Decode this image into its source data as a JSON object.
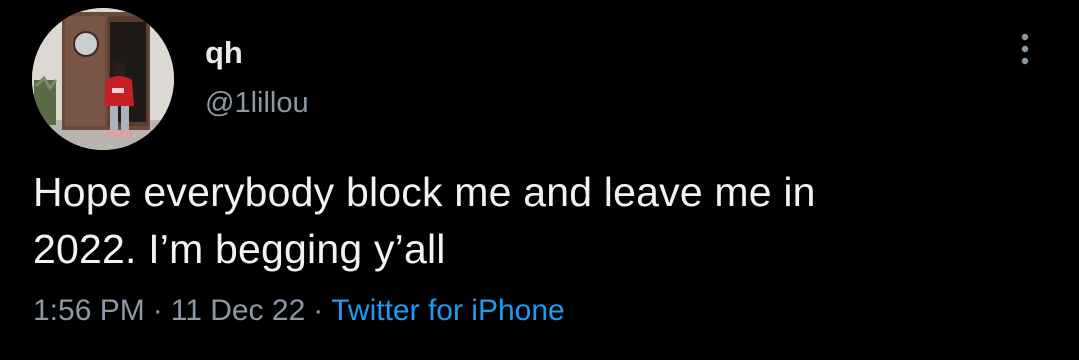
{
  "tweet": {
    "author": {
      "display_name": "qh",
      "handle": "@1lillou",
      "avatar_icon": "avatar-photo"
    },
    "text_lines": [
      "Hope everybody block me and leave me in",
      "2022. I’m begging y’all"
    ],
    "meta": {
      "time": "1:56 PM",
      "date": "11 Dec 22",
      "separator": "·",
      "source": "Twitter for iPhone"
    },
    "more_icon": "more-vertical-icon"
  },
  "colors": {
    "background": "#000000",
    "text": "#e7e9ea",
    "secondary": "#8b98a5",
    "link": "#1d9bf0"
  }
}
